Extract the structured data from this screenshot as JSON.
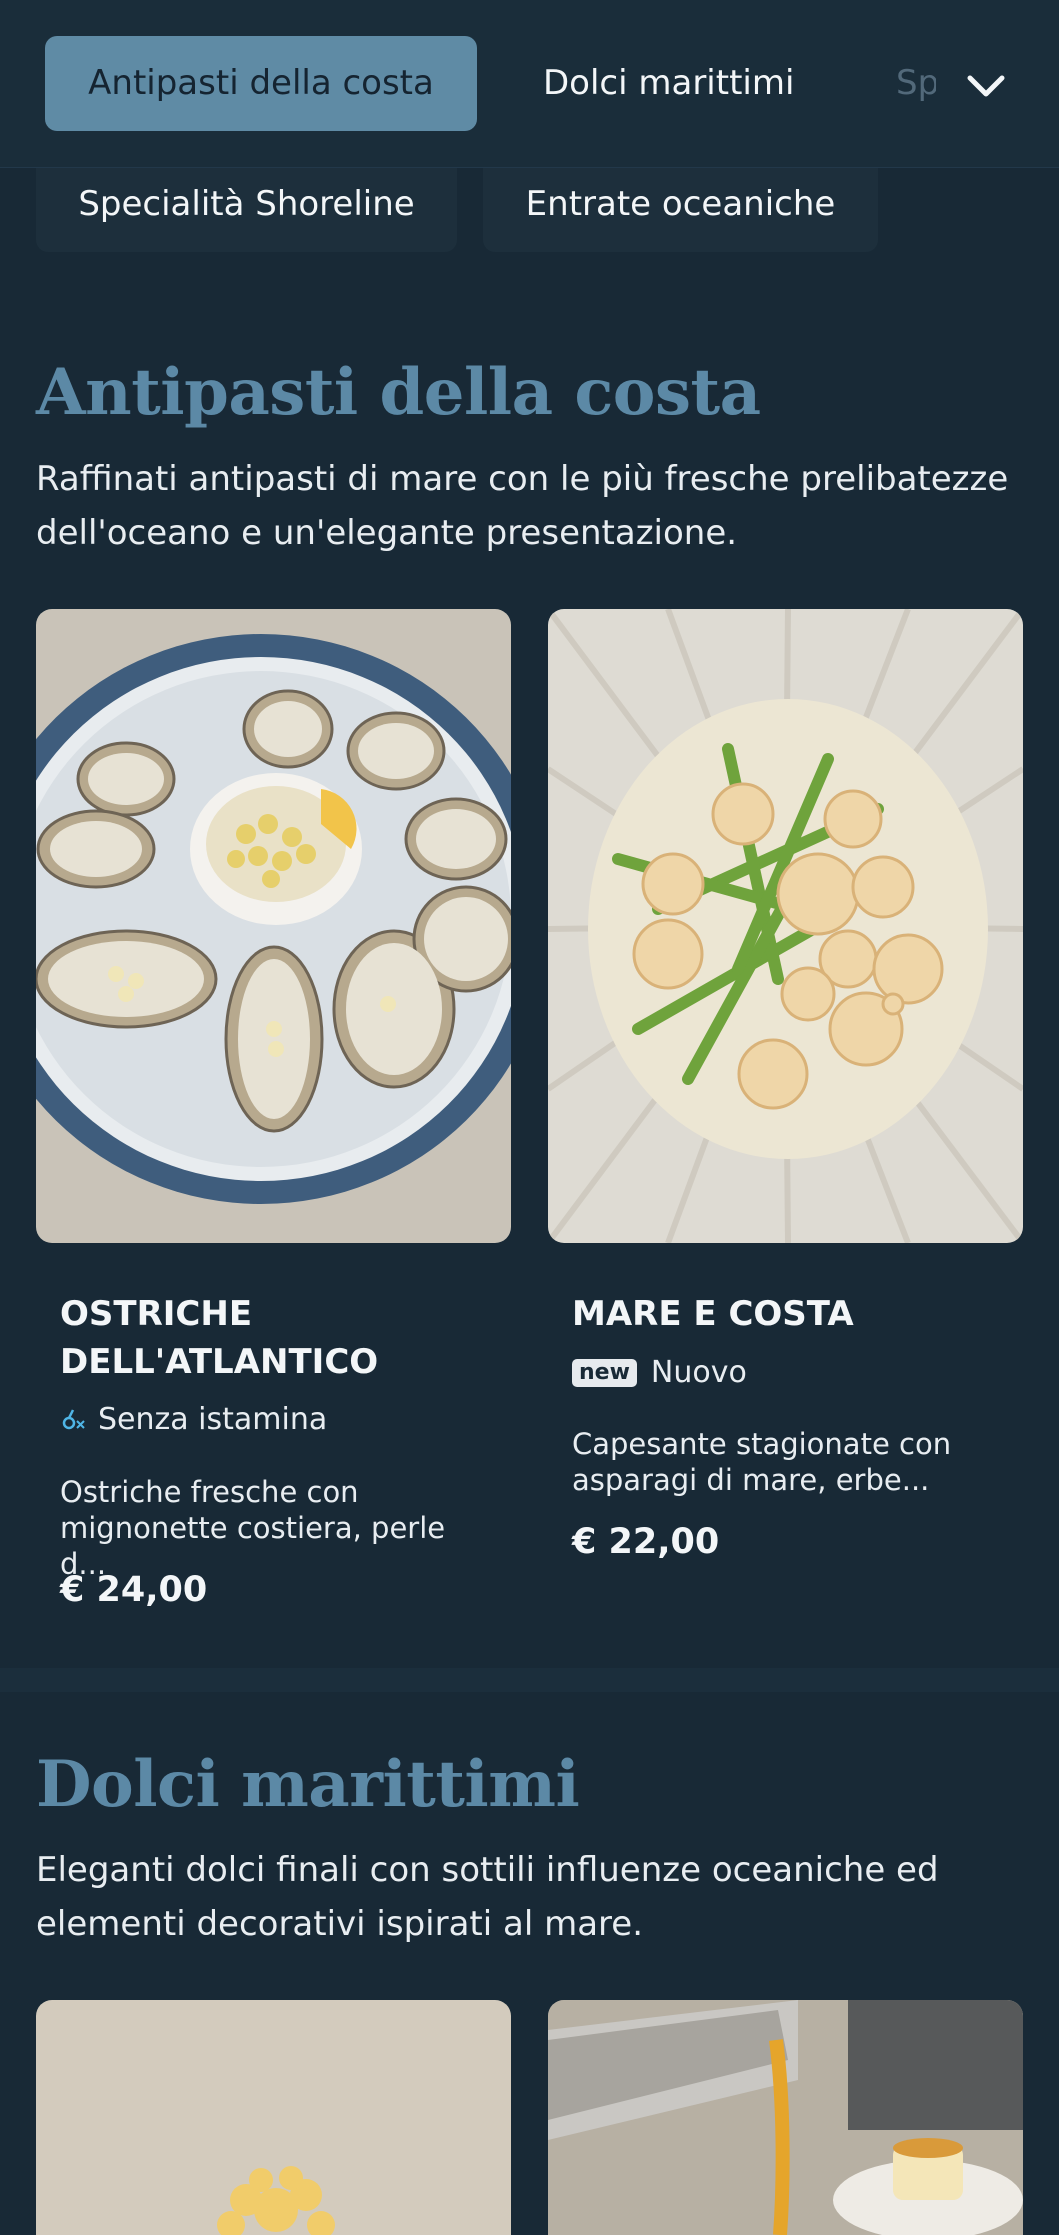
{
  "nav": {
    "tabs": [
      "Antipasti della costa",
      "Dolci marittimi",
      "Sp"
    ],
    "more_icon": "chevron-down-icon",
    "row2": [
      "Specialità Shoreline",
      "Entrate oceaniche"
    ]
  },
  "sections": [
    {
      "title": "Antipasti della costa",
      "description": "Raffinati antipasti di mare con le più fresche prelibatezze dell'oceano e un'elegante presentazione.",
      "items": [
        {
          "name": "OSTRICHE DELL'ATLANTICO",
          "tag": "Senza istamina",
          "tag_icon": "histamine-free-icon",
          "description": "Ostriche fresche con mignonette costiera, perle d...",
          "price": "€ 24,00"
        },
        {
          "name": "MARE E COSTA",
          "badge": "new",
          "tag": "Nuovo",
          "description": "Capesante stagionate con asparagi di mare, erbe...",
          "price": "€ 22,00"
        }
      ]
    },
    {
      "title": "Dolci marittimi",
      "description": "Eleganti dolci finali con sottili influenze oceaniche ed elementi decorativi ispirati al mare."
    }
  ],
  "colors": {
    "background": "#182936",
    "accent": "#5c89a6",
    "active_tab": "#5f8ba5",
    "text": "#f3f6f8"
  }
}
